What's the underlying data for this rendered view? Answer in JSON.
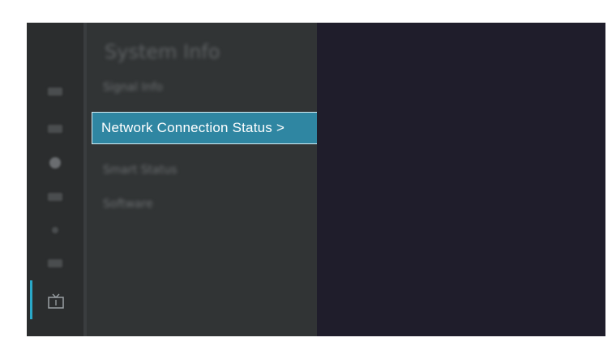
{
  "menu": {
    "title": "System Info",
    "items": [
      {
        "label": "Signal Info",
        "blurred": true
      },
      {
        "label": "Network Connection Status",
        "selected": true
      },
      {
        "label": "Smart Status",
        "blurred": true
      },
      {
        "label": "Software",
        "blurred": true
      }
    ],
    "chevron": ">"
  },
  "rail": {
    "icons": [
      "input-icon",
      "picture-icon",
      "sound-icon",
      "network-icon",
      "accessibility-icon",
      "apps-icon",
      "tv-icon"
    ],
    "active": "tv-icon"
  },
  "colors": {
    "selected_bg": "#2f86a2",
    "accent": "#2aa8c8",
    "panel_bg": "#1f1d2b"
  }
}
